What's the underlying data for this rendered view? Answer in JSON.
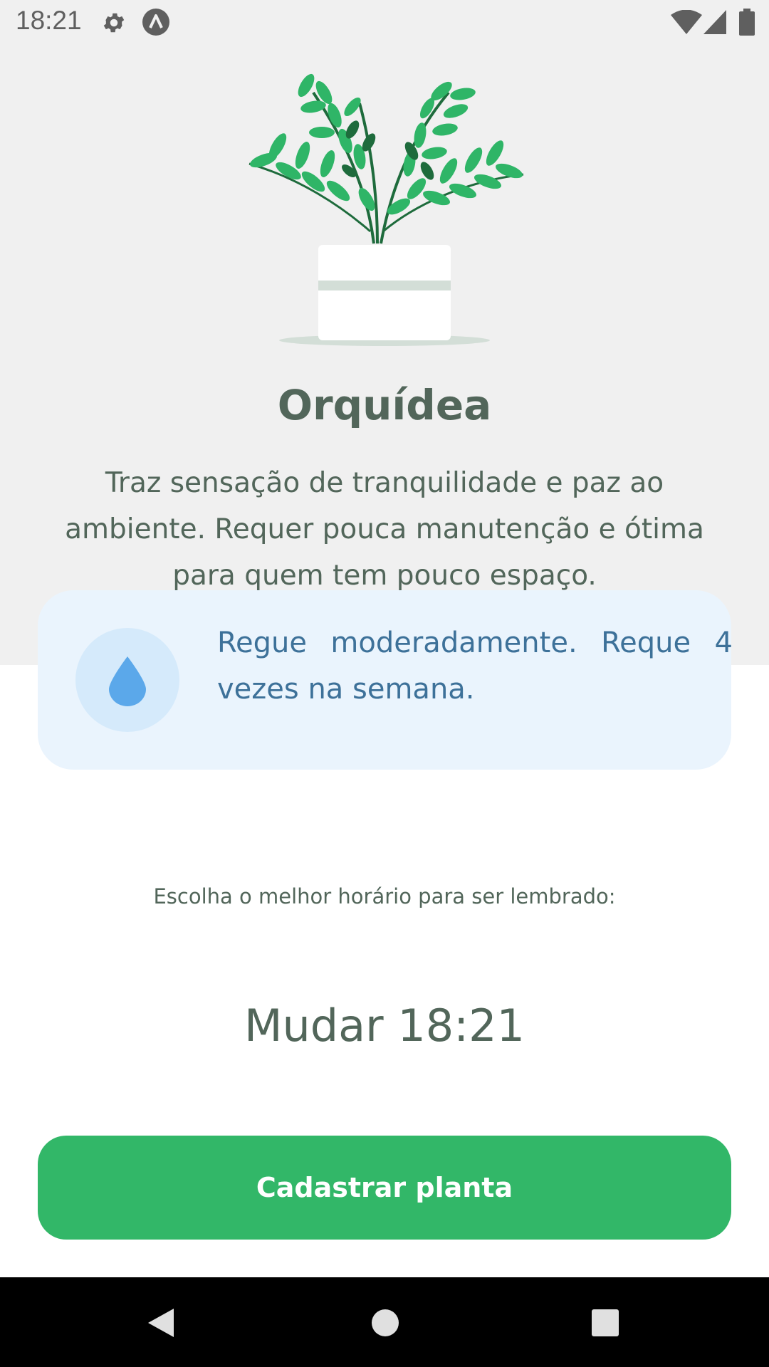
{
  "status_bar": {
    "time": "18:21",
    "icons": [
      "settings-icon",
      "app-notification-icon",
      "wifi-icon",
      "signal-icon",
      "battery-icon"
    ]
  },
  "plant": {
    "name": "Orquídea",
    "about": "Traz sensação de tranquilidade e paz ao ambiente. Requer pouca manutenção e ótima para quem tem pouco espaço."
  },
  "water_tip": {
    "icon": "water-drop-icon",
    "text": "Regue moderadamente. Reque 4 vezes na semana."
  },
  "reminder": {
    "label": "Escolha o melhor horário para ser lembrado:",
    "change_prefix": "Mudar",
    "time": "18:21"
  },
  "submit": {
    "label": "Cadastrar planta"
  },
  "nav_bar": {
    "buttons": [
      "back-icon",
      "home-icon",
      "recents-icon"
    ]
  },
  "colors": {
    "header_background": "#f0f0f0",
    "heading": "#52665a",
    "tip_background": "#eaf4fd",
    "tip_text": "#3d7199",
    "accent_green": "#32b768"
  }
}
